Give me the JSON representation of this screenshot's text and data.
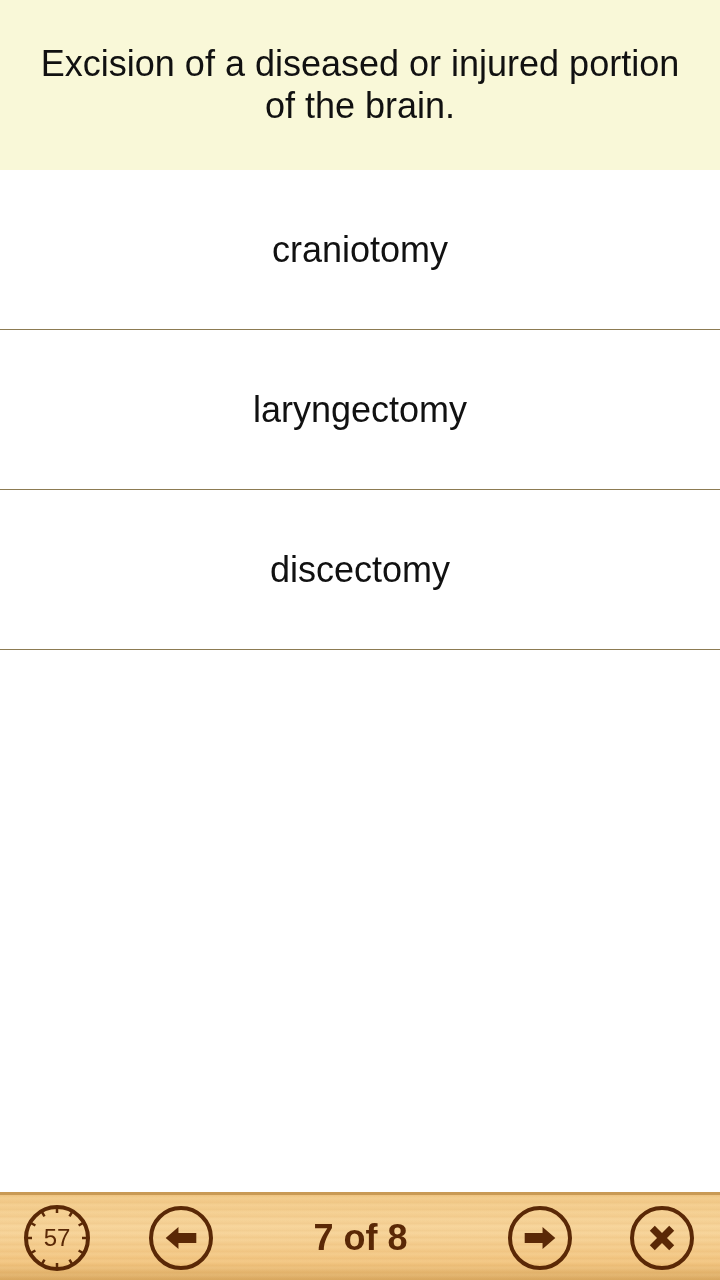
{
  "question": {
    "text": "Excision of a diseased or injured portion of the brain."
  },
  "answers": [
    "craniotomy",
    "laryngectomy",
    "discectomy"
  ],
  "toolbar": {
    "timer": "57",
    "counter": "7 of 8"
  }
}
